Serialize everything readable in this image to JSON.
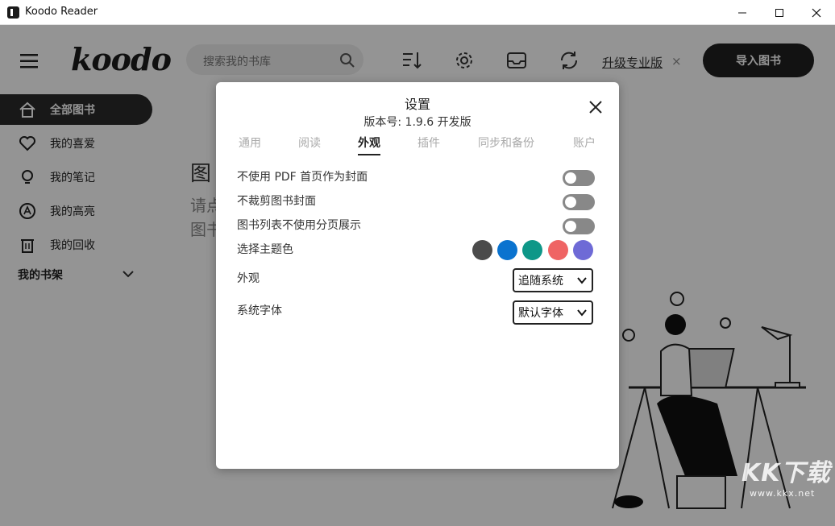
{
  "window": {
    "title": "Koodo Reader"
  },
  "header": {
    "logo": "koodo",
    "search_placeholder": "搜索我的书库",
    "upgrade_label": "升级专业版",
    "upgrade_close": "×",
    "import_label": "导入图书"
  },
  "sidebar": {
    "items": [
      {
        "label": "全部图书",
        "icon": "home-icon"
      },
      {
        "label": "我的喜爱",
        "icon": "heart-icon"
      },
      {
        "label": "我的笔记",
        "icon": "lightbulb-icon"
      },
      {
        "label": "我的高亮",
        "icon": "highlight-icon"
      },
      {
        "label": "我的回收",
        "icon": "trash-icon"
      }
    ],
    "shelf_label": "我的书架"
  },
  "main": {
    "empty_title": "图",
    "empty_line1": "请点",
    "empty_line2": "图书"
  },
  "settings": {
    "title": "设置",
    "version": "版本号: 1.9.6 开发版",
    "tabs": [
      "通用",
      "阅读",
      "外观",
      "插件",
      "同步和备份",
      "账户"
    ],
    "active_tab": "外观",
    "options": {
      "no_pdf_cover": "不使用 PDF 首页作为封面",
      "no_crop_cover": "不裁剪图书封面",
      "no_pagination": "图书列表不使用分页展示",
      "theme_color": "选择主题色",
      "appearance": "外观",
      "system_font": "系统字体"
    },
    "appearance_value": "追随系统",
    "font_value": "默认字体",
    "theme_colors": [
      "#4b4b4b",
      "#0a73cf",
      "#0e9788",
      "#ef6464",
      "#6e6ad6"
    ]
  },
  "watermark": {
    "main": "KK下载",
    "sub": "www.kkx.net"
  }
}
